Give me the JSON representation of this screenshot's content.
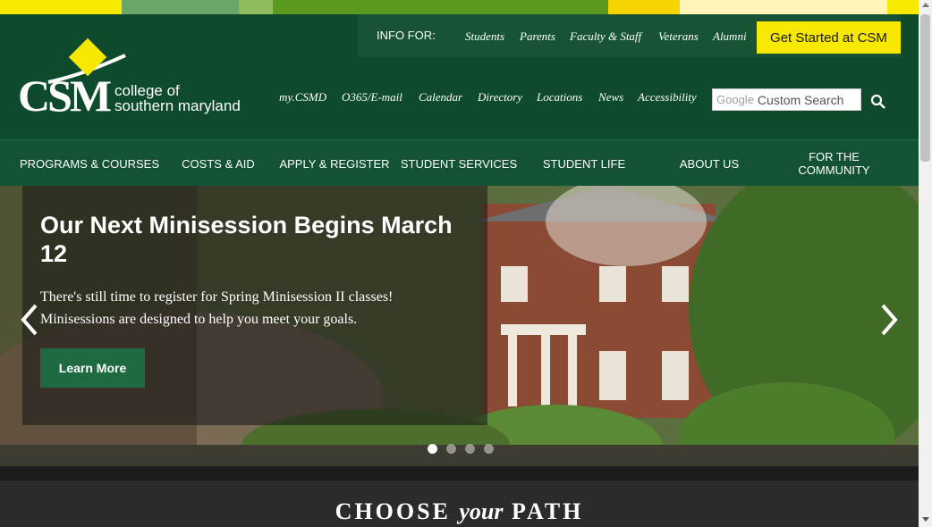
{
  "colors": {
    "strip": [
      "#f6e800",
      "#f6e800",
      "#6aa86a",
      "#8fbd5e",
      "#5b9a1f",
      "#5b9a1f",
      "#f6d400",
      "#fdf6b8",
      "#fdf6b8",
      "#f6e800"
    ],
    "header_bg": "#0e4a2c",
    "accent_yellow": "#f6e800",
    "button_green": "#1e6b41"
  },
  "info_bar": {
    "label": "INFO FOR:",
    "links": [
      "Students",
      "Parents",
      "Faculty & Staff",
      "Veterans",
      "Alumni"
    ],
    "cta": "Get Started at CSM"
  },
  "logo": {
    "acronym": "CSM",
    "name_line1": "college of",
    "name_line2": "southern maryland"
  },
  "utility_links": [
    "my.CSMD",
    "O365/E-mail",
    "Calendar",
    "Directory",
    "Locations",
    "News",
    "Accessibility"
  ],
  "search": {
    "brand": "Google",
    "placeholder": "Custom Search",
    "icon": "search-icon"
  },
  "nav": [
    "PROGRAMS & COURSES",
    "COSTS & AID",
    "APPLY & REGISTER",
    "STUDENT SERVICES",
    "STUDENT LIFE",
    "ABOUT US",
    "FOR THE COMMUNITY"
  ],
  "hero": {
    "title": "Our Next Minisession Begins March 12",
    "text": "There's still time to register for Spring Minisession II classes! Minisessions are designed to help you meet your goals.",
    "button": "Learn More",
    "prev_icon": "chevron-left-icon",
    "next_icon": "chevron-right-icon",
    "slide_count": 4,
    "active_slide": 1
  },
  "choose_path": {
    "word1": "CHOOSE",
    "word2": "your",
    "word3": "PATH"
  }
}
